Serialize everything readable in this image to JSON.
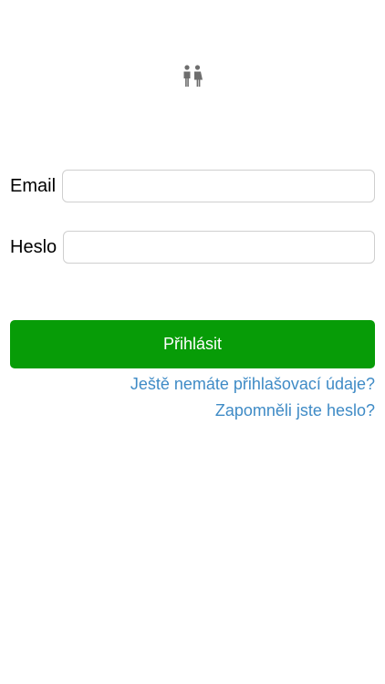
{
  "logo": {
    "icon": "couple-icon",
    "color": "#6e6e6e"
  },
  "form": {
    "email_label": "Email",
    "email_value": "",
    "password_label": "Heslo",
    "password_value": "",
    "submit_label": "Přihlásit"
  },
  "links": {
    "register": "Ještě nemáte přihlašovací údaje?",
    "forgot_password": "Zapomněli jste heslo?"
  },
  "colors": {
    "primary_button": "#079c07",
    "link": "#3f8bc6"
  }
}
